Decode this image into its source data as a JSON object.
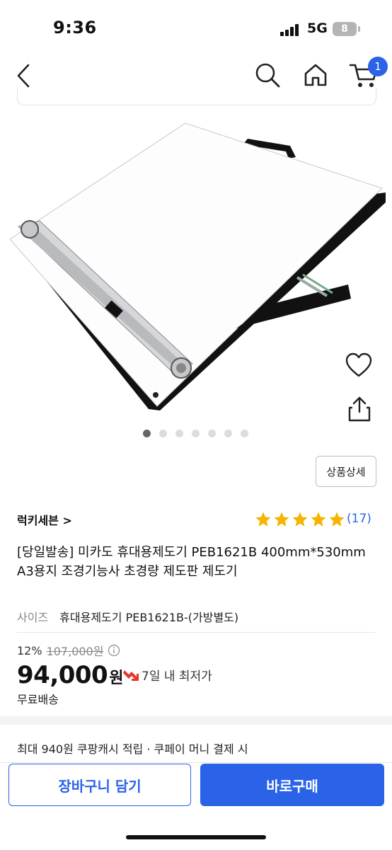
{
  "status_bar": {
    "time": "9:36",
    "network": "5G",
    "battery": "8"
  },
  "nav": {
    "cart_count": "1"
  },
  "icons": {
    "back": "chevron-left-icon",
    "search": "search-icon",
    "home": "home-icon",
    "cart": "cart-icon",
    "wishlist": "heart-icon",
    "share": "share-icon",
    "star": "star-icon",
    "info": "info-icon",
    "lowest_price": "arrow-down-icon"
  },
  "colors": {
    "accent": "#2a63e8",
    "star": "#f6b400",
    "lowest_arrow": "#e5372f"
  },
  "gallery": {
    "image_count": 7,
    "active_index": 0
  },
  "detail_button": "상품상세",
  "seller": {
    "name": "럭키세븐 >"
  },
  "rating": {
    "stars": 5,
    "count": "(17)"
  },
  "product": {
    "title": "[당일발송] 미카도 휴대용제도기 PEB1621B 400mm*530mm A3용지 조경기능사 초경량 제도판 제도기",
    "option_label": "사이즈",
    "option_value": "휴대용제도기 PEB1621B-(가방별도)"
  },
  "price": {
    "discount": "12%",
    "original": "107,000원",
    "current": "94,000",
    "currency": "원",
    "lowest_text": "7일 내 최저가",
    "shipping": "무료배송"
  },
  "cash_text": "최대 940원 쿠팡캐시 적립 · 쿠페이 머니 결제 시",
  "buttons": {
    "cart": "장바구니 담기",
    "buy": "바로구매"
  }
}
